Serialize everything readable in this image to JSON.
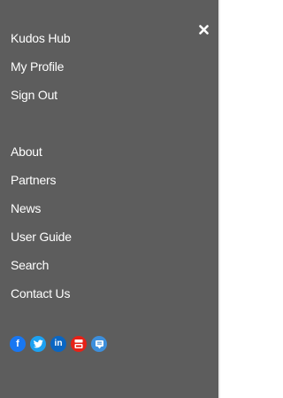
{
  "menu": {
    "close_icon": "close-icon",
    "account_items": [
      {
        "label": "Kudos Hub"
      },
      {
        "label": "My Profile"
      },
      {
        "label": "Sign Out"
      }
    ],
    "site_items": [
      {
        "label": "About"
      },
      {
        "label": "Partners"
      },
      {
        "label": "News"
      },
      {
        "label": "User Guide"
      },
      {
        "label": "Search"
      },
      {
        "label": "Contact Us"
      }
    ]
  },
  "social": [
    {
      "icon": "facebook-icon",
      "glyph": "f",
      "color": "#1877f2"
    },
    {
      "icon": "twitter-icon",
      "glyph": "",
      "color": "#1da1f2"
    },
    {
      "icon": "linkedin-icon",
      "glyph": "in",
      "color": "#0a66c2"
    },
    {
      "icon": "youtube-icon",
      "glyph": "",
      "color": "#e62117"
    },
    {
      "icon": "blog-icon",
      "glyph": "",
      "color": "#3d8fdc"
    }
  ],
  "colors": {
    "panel_background": "#5d5d5d",
    "text": "#ffffff"
  }
}
